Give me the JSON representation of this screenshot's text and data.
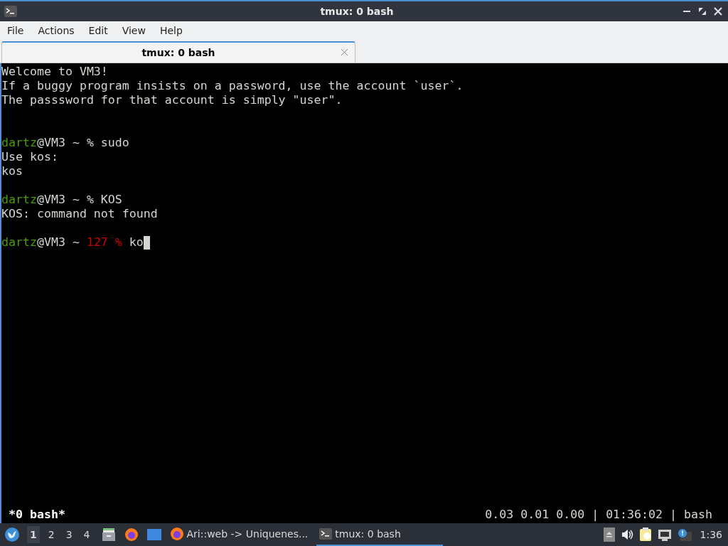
{
  "window": {
    "title": "tmux: 0 bash"
  },
  "menu": [
    "File",
    "Actions",
    "Edit",
    "View",
    "Help"
  ],
  "tabs": [
    {
      "label": "tmux: 0 bash",
      "selected": true
    }
  ],
  "terminal": {
    "lines": [
      {
        "kind": "text",
        "segments": [
          {
            "text": "Welcome to VM3!",
            "color": "#d3d7cf"
          }
        ]
      },
      {
        "kind": "text",
        "segments": [
          {
            "text": "If a buggy program insists on a password, use the account `user`.",
            "color": "#d3d7cf"
          }
        ]
      },
      {
        "kind": "text",
        "segments": [
          {
            "text": "The passsword for that account is simply \"user\".",
            "color": "#d3d7cf"
          }
        ]
      },
      {
        "kind": "blank"
      },
      {
        "kind": "blank"
      },
      {
        "kind": "text",
        "segments": [
          {
            "text": "dartz",
            "color": "#4e9a06"
          },
          {
            "text": "@VM3 ~ % sudo",
            "color": "#d3d7cf"
          }
        ]
      },
      {
        "kind": "text",
        "segments": [
          {
            "text": "Use kos:",
            "color": "#d3d7cf"
          }
        ]
      },
      {
        "kind": "text",
        "segments": [
          {
            "text": "kos",
            "color": "#d3d7cf"
          }
        ]
      },
      {
        "kind": "blank"
      },
      {
        "kind": "text",
        "segments": [
          {
            "text": "dartz",
            "color": "#4e9a06"
          },
          {
            "text": "@VM3 ~ % KOS",
            "color": "#d3d7cf"
          }
        ]
      },
      {
        "kind": "text",
        "segments": [
          {
            "text": "KOS: command not found",
            "color": "#d3d7cf"
          }
        ]
      },
      {
        "kind": "blank"
      },
      {
        "kind": "text",
        "cursor": true,
        "segments": [
          {
            "text": "dartz",
            "color": "#4e9a06"
          },
          {
            "text": "@VM3 ~ ",
            "color": "#d3d7cf"
          },
          {
            "text": "127 %",
            "color": "#cc0000"
          },
          {
            "text": " ko",
            "color": "#d3d7cf"
          }
        ]
      }
    ]
  },
  "tmux_status": {
    "window": "*0 bash*",
    "info": "0.03 0.01 0.00 | 01:36:02 | bash"
  },
  "taskbar": {
    "workspaces": [
      {
        "label": "1",
        "selected": true
      },
      {
        "label": "2",
        "selected": false
      },
      {
        "label": "3",
        "selected": false
      },
      {
        "label": "4",
        "selected": false
      }
    ],
    "launchers": [
      {
        "kind": "files"
      },
      {
        "kind": "browser"
      },
      {
        "kind": "desktop"
      }
    ],
    "tasks": [
      {
        "kind": "browser",
        "label": "Ari::web -> Uniquenes...",
        "selected": false
      },
      {
        "kind": "terminal",
        "label": "tmux: 0 bash",
        "selected": true
      }
    ],
    "clock": "1:36"
  }
}
